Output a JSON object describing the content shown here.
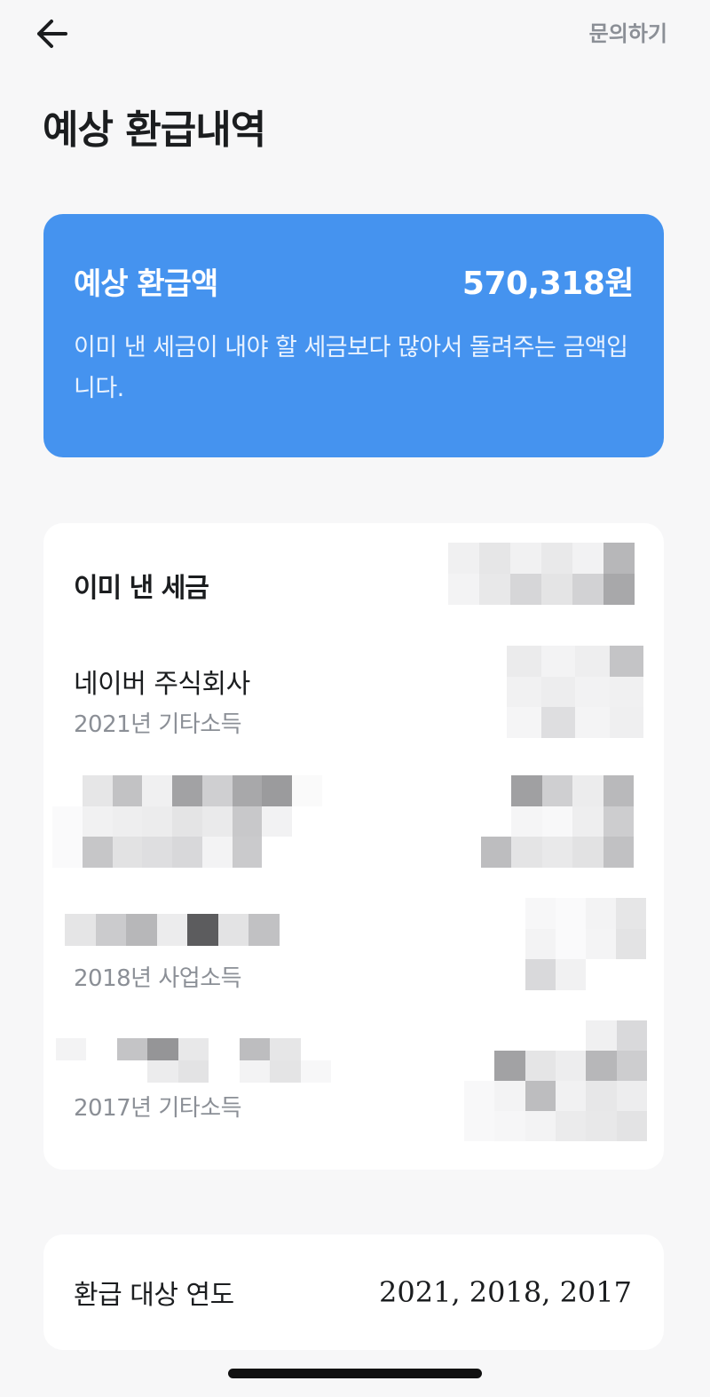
{
  "header": {
    "back_icon": "arrow-left-icon",
    "inquiry_label": "문의하기",
    "title": "예상 환급내역"
  },
  "summary": {
    "label": "예상 환급액",
    "amount": "570,318원",
    "description": "이미 낸 세금이 내야 할 세금보다 많아서 돌려주는 금액입니다.",
    "color": "#4593ef"
  },
  "taxes": {
    "title": "이미 낸 세금",
    "items": [
      {
        "name": "네이버 주식회사",
        "income_type": "2021년 기타소득"
      },
      {
        "income_type": "2018년 사업소득"
      },
      {
        "income_type": "2017년 기타소득"
      }
    ]
  },
  "refund_years": {
    "label": "환급 대상 연도",
    "value": "2021, 2018, 2017"
  }
}
